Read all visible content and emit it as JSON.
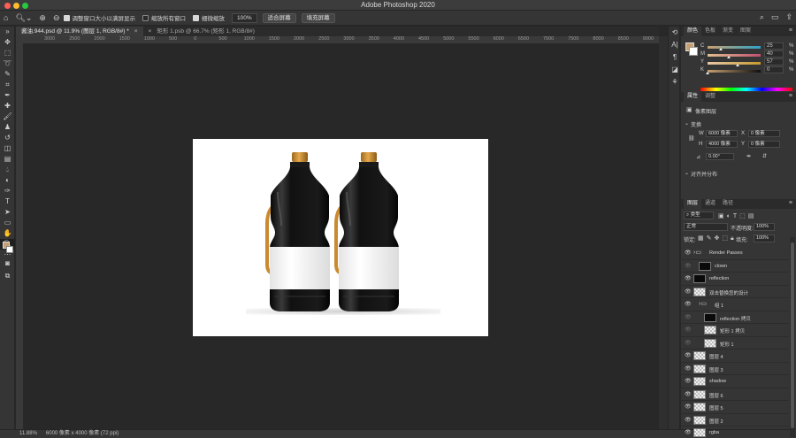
{
  "app": {
    "title": "Adobe Photoshop 2020"
  },
  "options_bar": {
    "checkbox_resize": "调整窗口大小以满屏显示",
    "checkbox_all_windows": "缩放所有窗口",
    "checkbox_scrubby": "细微缩放",
    "zoom_value": "100%",
    "btn_fit": "适合屏幕",
    "btn_fill": "填充屏幕"
  },
  "tabs": [
    {
      "label": "酱油.944.psd @ 11.9% (图层 1, RGB/8#) *",
      "close": "×"
    },
    {
      "label": "矩形 1.psb @ 66.7% (矩形 1, RGB/8#)",
      "close": "×"
    }
  ],
  "ruler_top": [
    "3000",
    "2500",
    "2000",
    "1500",
    "1000",
    "500",
    "0",
    "500",
    "1000",
    "1500",
    "2000",
    "2500",
    "3000",
    "3500",
    "4000",
    "4500",
    "5000",
    "5500",
    "6000",
    "6500",
    "7000",
    "7500",
    "8000",
    "8500",
    "9000"
  ],
  "status": {
    "zoom": "11.88%",
    "dims": "6000 像素 x 4000 像素 (72 ppi)"
  },
  "color_panel": {
    "tabs": [
      "颜色",
      "色板",
      "渐变",
      "图案"
    ],
    "colors": {
      "foreground": "#c7a071",
      "background": "#ffffff"
    },
    "sliders": [
      {
        "label": "C",
        "value": "25",
        "unit": "%",
        "level": 0.25
      },
      {
        "label": "M",
        "value": "40",
        "unit": "%",
        "level": 0.4
      },
      {
        "label": "Y",
        "value": "57",
        "unit": "%",
        "level": 0.57
      },
      {
        "label": "K",
        "value": "0",
        "unit": "%",
        "level": 0.0
      }
    ]
  },
  "properties_panel": {
    "tabs": [
      "属性",
      "调整"
    ],
    "type_label": "像素图层",
    "section_transform": "变换",
    "w_label": "W",
    "w_value": "6000 像素",
    "x_label": "X",
    "x_value": "0 像素",
    "h_label": "H",
    "h_value": "4000 像素",
    "y_label": "Y",
    "y_value": "0 像素",
    "angle_value": "0.00°",
    "section_align": "对齐并分布"
  },
  "layers_panel": {
    "tabs": [
      "图层",
      "通道",
      "路径"
    ],
    "filter_label": "类型",
    "blend_mode": "正常",
    "opacity_label": "不透明度:",
    "opacity_value": "100%",
    "lock_label": "锁定:",
    "fill_label": "填充:",
    "fill_value": "100%",
    "layers": [
      {
        "name": "Render Passes",
        "kind": "folder",
        "eye": true
      },
      {
        "name": "clown",
        "kind": "black",
        "eye": false
      },
      {
        "name": "reflection",
        "kind": "black",
        "eye": true
      },
      {
        "name": "双击替换您的设计",
        "kind": "checker",
        "eye": true
      },
      {
        "name": "组 1",
        "kind": "folder",
        "eye": true
      },
      {
        "name": "reflection 拷贝",
        "kind": "black",
        "eye": false
      },
      {
        "name": "矩形 1 拷贝",
        "kind": "checker",
        "eye": false
      },
      {
        "name": "矩形 1",
        "kind": "checker",
        "eye": false
      },
      {
        "name": "图层 4",
        "kind": "checker",
        "eye": true
      },
      {
        "name": "图层 3",
        "kind": "checker",
        "eye": true
      },
      {
        "name": "shadow",
        "kind": "checker",
        "eye": true
      },
      {
        "name": "图层 6",
        "kind": "checker",
        "eye": true
      },
      {
        "name": "图层 5",
        "kind": "checker",
        "eye": true
      },
      {
        "name": "图层 2",
        "kind": "checker",
        "eye": true
      },
      {
        "name": "rgba",
        "kind": "checker",
        "eye": true
      }
    ]
  }
}
